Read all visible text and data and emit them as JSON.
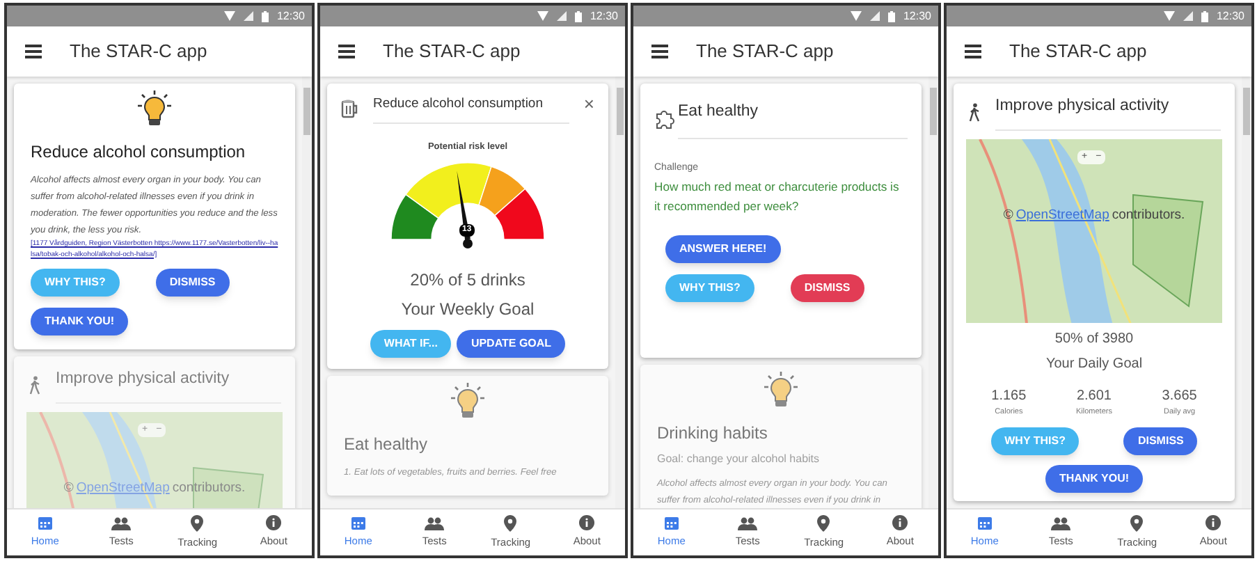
{
  "phones": [
    {
      "status_time": "12:30",
      "app_title": "The STAR-C app",
      "cards": [
        {
          "kind": "tip",
          "faded": false,
          "title": "Reduce alcohol consumption",
          "body": "Alcohol affects almost every organ in your body. You can suffer from alcohol-related illnesses even if you drink in moderation. The fewer opportunities you reduce and the less you drink, the less you risk.",
          "link": "[1177 Vårdguiden, Region Västerbotten https://www.1177.se/Vasterbotten/liv--halsa/tobak-och-alkohol/alkohol-och-halsa/]",
          "button_rows": [
            [
              {
                "label": "WHY THIS?",
                "color": "#43b6f0"
              },
              {
                "label": "DISMISS",
                "color": "#3f6ee8"
              }
            ],
            [
              {
                "label": "THANK YOU!",
                "color": "#3f6ee8"
              }
            ]
          ]
        },
        {
          "kind": "activity",
          "faded": true,
          "title": "Improve physical activity",
          "map": {
            "zoom_controls": [
              "+",
              "−"
            ],
            "attribution_prefix": "©",
            "attribution_link": "OpenStreetMap",
            "attribution_suffix": "contributors."
          }
        }
      ],
      "nav": [
        {
          "label": "Home",
          "selected": true
        },
        {
          "label": "Tests",
          "selected": false
        },
        {
          "label": "Tracking",
          "selected": false
        },
        {
          "label": "About",
          "selected": false
        }
      ]
    },
    {
      "status_time": "12:30",
      "app_title": "The STAR-C app",
      "cards": [
        {
          "kind": "gauge",
          "faded": false,
          "title": "Reduce alcohol consumption",
          "close": "×",
          "gauge_label": "Potential risk level",
          "level": 0.45,
          "reading": "13",
          "progress": "20% of 5 drinks",
          "goal": "Your Weekly Goal",
          "button_rows": [
            [
              {
                "label": "WHAT IF...",
                "color": "#43b6f0"
              },
              {
                "label": "UPDATE GOAL",
                "color": "#3f6ee8"
              }
            ]
          ]
        },
        {
          "kind": "tip",
          "faded": true,
          "title": "Eat healthy",
          "body": "1. Eat lots of vegetables, fruits and berries. Feel free"
        }
      ],
      "nav": [
        {
          "label": "Home",
          "selected": true
        },
        {
          "label": "Tests",
          "selected": false
        },
        {
          "label": "Tracking",
          "selected": false
        },
        {
          "label": "About",
          "selected": false
        }
      ]
    },
    {
      "status_time": "12:30",
      "app_title": "The STAR-C app",
      "cards": [
        {
          "kind": "challenge",
          "faded": false,
          "title": "Eat healthy",
          "label": "Challenge",
          "question": "How much red meat or charcuterie products is it recommended per week?",
          "button_rows": [
            [
              {
                "label": "ANSWER HERE!",
                "color": "#3f6ee8"
              }
            ],
            [
              {
                "label": "WHY THIS?",
                "color": "#43b6f0"
              },
              {
                "label": "DISMISS",
                "color": "#e23c55"
              }
            ]
          ]
        },
        {
          "kind": "tip",
          "faded": true,
          "title": "Drinking habits",
          "subtitle": "Goal: change your alcohol habits",
          "body": "Alcohol affects almost every organ in your body. You can suffer from alcohol-related illnesses even if you drink in"
        }
      ],
      "nav": [
        {
          "label": "Home",
          "selected": true
        },
        {
          "label": "Tests",
          "selected": false
        },
        {
          "label": "Tracking",
          "selected": false
        },
        {
          "label": "About",
          "selected": false
        }
      ]
    },
    {
      "status_time": "12:30",
      "app_title": "The STAR-C app",
      "cards": [
        {
          "kind": "activity",
          "faded": false,
          "title": "Improve physical activity",
          "map": {
            "zoom_controls": [
              "+",
              "−"
            ],
            "attribution_prefix": "©",
            "attribution_link": "OpenStreetMap",
            "attribution_suffix": "contributors."
          },
          "progress": "50% of 3980",
          "goal": "Your Daily Goal",
          "stats": [
            {
              "value": "1.165",
              "label": "Calories"
            },
            {
              "value": "2.601",
              "label": "Kilometers"
            },
            {
              "value": "3.665",
              "label": "Daily avg"
            }
          ],
          "button_rows": [
            [
              {
                "label": "WHY THIS?",
                "color": "#43b6f0"
              },
              {
                "label": "DISMISS",
                "color": "#3f6ee8"
              }
            ],
            [
              {
                "label": "THANK YOU!",
                "color": "#3f6ee8"
              }
            ]
          ]
        }
      ],
      "nav": [
        {
          "label": "Home",
          "selected": true
        },
        {
          "label": "Tests",
          "selected": false
        },
        {
          "label": "Tracking",
          "selected": false
        },
        {
          "label": "About",
          "selected": false
        }
      ]
    }
  ]
}
